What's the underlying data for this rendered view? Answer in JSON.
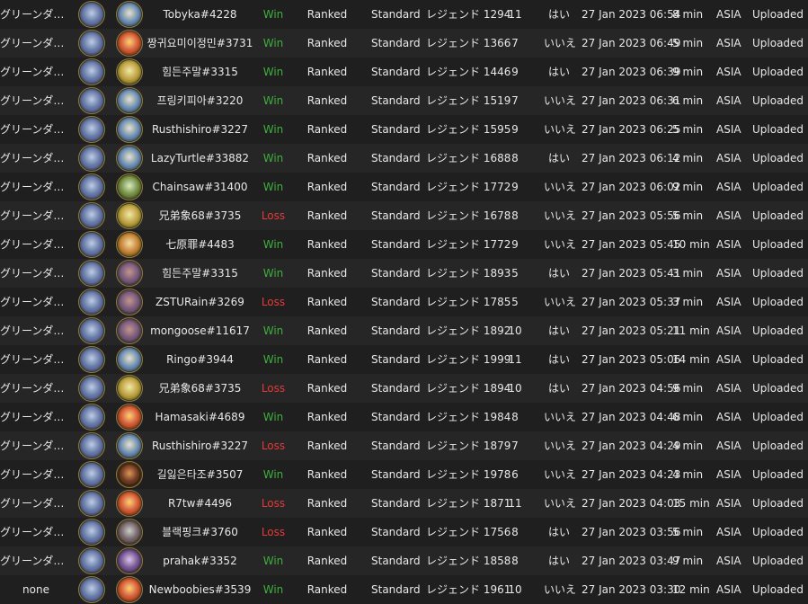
{
  "rows": [
    {
      "deck": "グリーンダカラ...",
      "hero": "sword",
      "opp_hero": "scroll",
      "opponent": "Tobyka#4228",
      "result": "Win",
      "mode": "Ranked",
      "format": "Standard",
      "rank": "レジェンド 1294",
      "turns": "11",
      "coin": "はい",
      "date": "27 Jan 2023 06:54",
      "duration": "8 min",
      "region": "ASIA",
      "status": "Uploaded"
    },
    {
      "deck": "グリーンダカラ...",
      "hero": "sword",
      "opp_hero": "fire",
      "opponent": "짱귀요미이정민#3731",
      "result": "Win",
      "mode": "Ranked",
      "format": "Standard",
      "rank": "レジェンド 1366",
      "turns": "7",
      "coin": "いいえ",
      "date": "27 Jan 2023 06:49",
      "duration": "5 min",
      "region": "ASIA",
      "status": "Uploaded"
    },
    {
      "deck": "グリーンダカラ...",
      "hero": "sword",
      "opp_hero": "gold",
      "opponent": "힘든주말#3315",
      "result": "Win",
      "mode": "Ranked",
      "format": "Standard",
      "rank": "レジェンド 1446",
      "turns": "9",
      "coin": "はい",
      "date": "27 Jan 2023 06:39",
      "duration": "9 min",
      "region": "ASIA",
      "status": "Uploaded"
    },
    {
      "deck": "グリーンダカラ...",
      "hero": "sword",
      "opp_hero": "scroll",
      "opponent": "프링키피아#3220",
      "result": "Win",
      "mode": "Ranked",
      "format": "Standard",
      "rank": "レジェンド 1519",
      "turns": "7",
      "coin": "いいえ",
      "date": "27 Jan 2023 06:31",
      "duration": "6 min",
      "region": "ASIA",
      "status": "Uploaded"
    },
    {
      "deck": "グリーンダカラ...",
      "hero": "sword",
      "opp_hero": "scroll",
      "opponent": "Rusthishiro#3227",
      "result": "Win",
      "mode": "Ranked",
      "format": "Standard",
      "rank": "レジェンド 1595",
      "turns": "9",
      "coin": "いいえ",
      "date": "27 Jan 2023 06:25",
      "duration": "5 min",
      "region": "ASIA",
      "status": "Uploaded"
    },
    {
      "deck": "グリーンダカラ...",
      "hero": "sword",
      "opp_hero": "scroll",
      "opponent": "LazyTurtle#33882",
      "result": "Win",
      "mode": "Ranked",
      "format": "Standard",
      "rank": "レジェンド 1688",
      "turns": "8",
      "coin": "はい",
      "date": "27 Jan 2023 06:12",
      "duration": "4 min",
      "region": "ASIA",
      "status": "Uploaded"
    },
    {
      "deck": "グリーンダカラ...",
      "hero": "sword",
      "opp_hero": "green",
      "opponent": "Chainsaw#31400",
      "result": "Win",
      "mode": "Ranked",
      "format": "Standard",
      "rank": "レジェンド 1772",
      "turns": "9",
      "coin": "いいえ",
      "date": "27 Jan 2023 06:02",
      "duration": "9 min",
      "region": "ASIA",
      "status": "Uploaded"
    },
    {
      "deck": "グリーンダカラ...",
      "hero": "sword",
      "opp_hero": "gold",
      "opponent": "兄弟象68#3735",
      "result": "Loss",
      "mode": "Ranked",
      "format": "Standard",
      "rank": "レジェンド 1678",
      "turns": "8",
      "coin": "いいえ",
      "date": "27 Jan 2023 05:56",
      "duration": "5 min",
      "region": "ASIA",
      "status": "Uploaded"
    },
    {
      "deck": "グリーンダカラ...",
      "hero": "sword",
      "opp_hero": "bronze",
      "opponent": "七原罪#4483",
      "result": "Win",
      "mode": "Ranked",
      "format": "Standard",
      "rank": "レジェンド 1772",
      "turns": "9",
      "coin": "いいえ",
      "date": "27 Jan 2023 05:45",
      "duration": "10 min",
      "region": "ASIA",
      "status": "Uploaded"
    },
    {
      "deck": "グリーンダカラ...",
      "hero": "sword",
      "opp_hero": "rogue",
      "opponent": "힘든주말#3315",
      "result": "Win",
      "mode": "Ranked",
      "format": "Standard",
      "rank": "レジェンド 1893",
      "turns": "5",
      "coin": "はい",
      "date": "27 Jan 2023 05:41",
      "duration": "3 min",
      "region": "ASIA",
      "status": "Uploaded"
    },
    {
      "deck": "グリーンダカラ",
      "hero": "sword",
      "opp_hero": "rogue",
      "opponent": "ZSTURain#3269",
      "result": "Loss",
      "mode": "Ranked",
      "format": "Standard",
      "rank": "レジェンド 1785",
      "turns": "5",
      "coin": "いいえ",
      "date": "27 Jan 2023 05:37",
      "duration": "3 min",
      "region": "ASIA",
      "status": "Uploaded"
    },
    {
      "deck": "グリーンダカラ",
      "hero": "sword",
      "opp_hero": "rogue",
      "opponent": "mongoose#11617",
      "result": "Win",
      "mode": "Ranked",
      "format": "Standard",
      "rank": "レジェンド 1892",
      "turns": "10",
      "coin": "はい",
      "date": "27 Jan 2023 05:21",
      "duration": "11 min",
      "region": "ASIA",
      "status": "Uploaded"
    },
    {
      "deck": "グリーンダカラ",
      "hero": "sword",
      "opp_hero": "scroll",
      "opponent": "Ringo#3944",
      "result": "Win",
      "mode": "Ranked",
      "format": "Standard",
      "rank": "レジェンド 1999",
      "turns": "11",
      "coin": "はい",
      "date": "27 Jan 2023 05:06",
      "duration": "14 min",
      "region": "ASIA",
      "status": "Uploaded"
    },
    {
      "deck": "グリーンダカラ",
      "hero": "sword",
      "opp_hero": "gold",
      "opponent": "兄弟象68#3735",
      "result": "Loss",
      "mode": "Ranked",
      "format": "Standard",
      "rank": "レジェンド 1894",
      "turns": "10",
      "coin": "はい",
      "date": "27 Jan 2023 04:56",
      "duration": "9 min",
      "region": "ASIA",
      "status": "Uploaded"
    },
    {
      "deck": "グリーンダカラ",
      "hero": "sword",
      "opp_hero": "fire",
      "opponent": "Hamasaki#4689",
      "result": "Win",
      "mode": "Ranked",
      "format": "Standard",
      "rank": "レジェンド 1984",
      "turns": "8",
      "coin": "いいえ",
      "date": "27 Jan 2023 04:48",
      "duration": "6 min",
      "region": "ASIA",
      "status": "Uploaded"
    },
    {
      "deck": "グリーンダカラ",
      "hero": "sword",
      "opp_hero": "scroll",
      "opponent": "Rusthishiro#3227",
      "result": "Loss",
      "mode": "Ranked",
      "format": "Standard",
      "rank": "レジェンド 1879",
      "turns": "7",
      "coin": "いいえ",
      "date": "27 Jan 2023 04:29",
      "duration": "4 min",
      "region": "ASIA",
      "status": "Uploaded"
    },
    {
      "deck": "グリーンダカラ",
      "hero": "sword",
      "opp_hero": "shadow",
      "opponent": "길잃은타조#3507",
      "result": "Win",
      "mode": "Ranked",
      "format": "Standard",
      "rank": "レジェンド 1978",
      "turns": "6",
      "coin": "いいえ",
      "date": "27 Jan 2023 04:23",
      "duration": "4 min",
      "region": "ASIA",
      "status": "Uploaded"
    },
    {
      "deck": "グリーンダカラ",
      "hero": "sword",
      "opp_hero": "fire",
      "opponent": "R7tw#4496",
      "result": "Loss",
      "mode": "Ranked",
      "format": "Standard",
      "rank": "レジェンド 1871",
      "turns": "11",
      "coin": "いいえ",
      "date": "27 Jan 2023 04:03",
      "duration": "15 min",
      "region": "ASIA",
      "status": "Uploaded"
    },
    {
      "deck": "グリーンダカラ",
      "hero": "sword",
      "opp_hero": "dark",
      "opponent": "블랙핑크#3760",
      "result": "Loss",
      "mode": "Ranked",
      "format": "Standard",
      "rank": "レジェンド 1756",
      "turns": "8",
      "coin": "はい",
      "date": "27 Jan 2023 03:56",
      "duration": "5 min",
      "region": "ASIA",
      "status": "Uploaded"
    },
    {
      "deck": "グリーンダカラ",
      "hero": "sword",
      "opp_hero": "purple",
      "opponent": "prahak#3352",
      "result": "Win",
      "mode": "Ranked",
      "format": "Standard",
      "rank": "レジェンド 1858",
      "turns": "8",
      "coin": "はい",
      "date": "27 Jan 2023 03:47",
      "duration": "9 min",
      "region": "ASIA",
      "status": "Uploaded"
    },
    {
      "deck": "none",
      "hero": "sword",
      "opp_hero": "fire",
      "opponent": "Newboobies#3539",
      "result": "Win",
      "mode": "Ranked",
      "format": "Standard",
      "rank": "レジェンド 1961",
      "turns": "10",
      "coin": "いいえ",
      "date": "27 Jan 2023 03:30",
      "duration": "12 min",
      "region": "ASIA",
      "status": "Uploaded"
    }
  ],
  "colors": {
    "win": "#3fae3f",
    "loss": "#e23b3b",
    "background": "#1f1f1f",
    "row_alt": "#262626",
    "text": "#e8e8e8"
  }
}
